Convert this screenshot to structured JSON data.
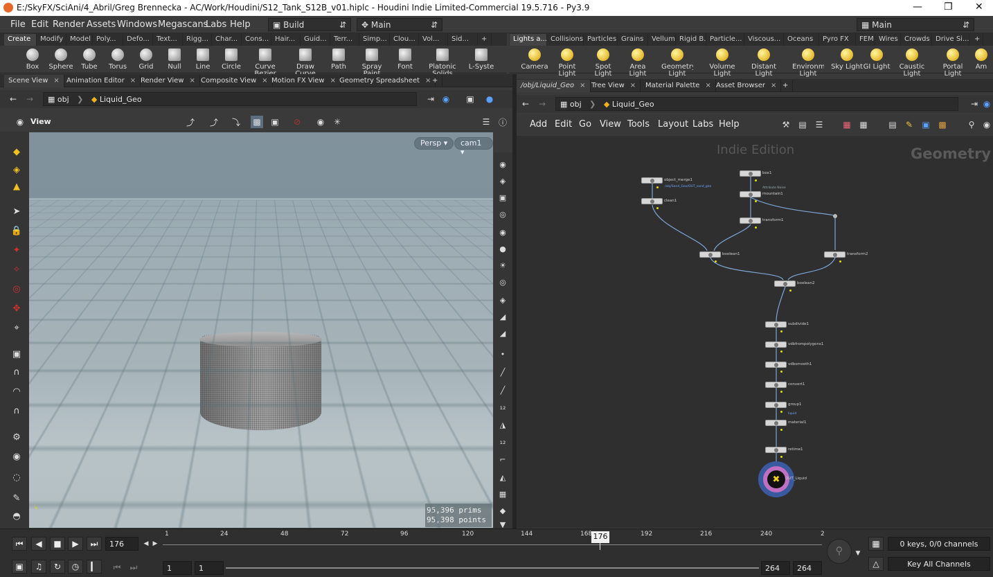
{
  "window": {
    "title": "E:/SkyFX/SciAni/4_Abril/Greg Brennecka - AC/Work/Houdini/S12_Tank_S12B_v01.hiplc - Houdini Indie Limited-Commercial 19.5.716 - Py3.9"
  },
  "menu": [
    "File",
    "Edit",
    "Render",
    "Assets",
    "Windows",
    "Megascans",
    "Labs",
    "Help"
  ],
  "desktops": {
    "left": "Build",
    "center": "Main",
    "right": "Main"
  },
  "shelf_tabs_left": [
    "Create",
    "Modify",
    "Model",
    "Poly...",
    "Defo...",
    "Text...",
    "Rigg...",
    "Char...",
    "Cons...",
    "Hair...",
    "Guid...",
    "Terr...",
    "Simp...",
    "Clou...",
    "Vol...",
    "Sid..."
  ],
  "shelf_tools_left": [
    "Box",
    "Sphere",
    "Tube",
    "Torus",
    "Grid",
    "Null",
    "Line",
    "Circle",
    "Curve Bezier",
    "Draw Curve",
    "Path",
    "Spray Paint",
    "Font",
    "Platonic Solids",
    "L-Syste"
  ],
  "shelf_tabs_right": [
    "Lights a...",
    "Collisions",
    "Particles",
    "Grains",
    "Vellum",
    "Rigid B...",
    "Particle...",
    "Viscous...",
    "Oceans",
    "Pyro FX",
    "FEM",
    "Wires",
    "Crowds",
    "Drive Si..."
  ],
  "shelf_tools_right": [
    "Camera",
    "Point Light",
    "Spot Light",
    "Area Light",
    "Geometry Light",
    "Volume Light",
    "Distant Light",
    "Environment Light",
    "Sky Light",
    "GI Light",
    "Caustic Light",
    "Portal Light",
    "Am"
  ],
  "left_pane_tabs": [
    "Scene View",
    "Animation Editor",
    "Render View",
    "Composite View",
    "Motion FX View",
    "Geometry Spreadsheet"
  ],
  "right_pane_tabs": [
    "/obj/Liquid_Geo",
    "Tree View",
    "Material Palette",
    "Asset Browser"
  ],
  "path": {
    "root": "obj",
    "node": "Liquid_Geo"
  },
  "viewer": {
    "label": "View",
    "persp": "Persp",
    "cam": "cam1",
    "prims": "95,396  prims",
    "points": "95,398  points"
  },
  "network": {
    "menu": [
      "Add",
      "Edit",
      "Go",
      "View",
      "Tools",
      "Layout",
      "Labs",
      "Help"
    ],
    "watermark": "Indie Edition",
    "context": "Geometry",
    "nodes": [
      "object_merge1",
      "clean1",
      "box1",
      "mountain1",
      "transform1",
      "boolean1",
      "transform2",
      "boolean2",
      "subdivide1",
      "vdbfrompolygons1",
      "vdbsmooth1",
      "convert1",
      "group1",
      "material1",
      "retime1",
      "OUT_Liquid"
    ],
    "subtext": {
      "merge_path": "/obj/Sand_Geo/OUT_sand_geo",
      "mountain": "Attribute Noise",
      "group": "liquid"
    }
  },
  "timeline": {
    "ticks": [
      "1",
      "24",
      "48",
      "72",
      "96",
      "120",
      "144",
      "168",
      "192",
      "216",
      "240",
      "2"
    ],
    "current_frame": "176",
    "start": "1",
    "start2": "1",
    "end": "264",
    "end2": "264",
    "keys": "0 keys, 0/0 channels",
    "key_all": "Key All Channels"
  }
}
